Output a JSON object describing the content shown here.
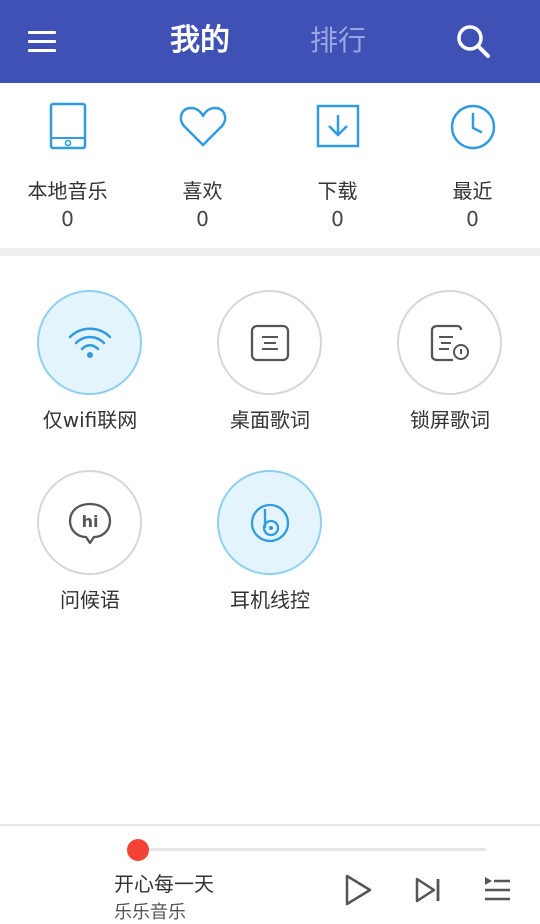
{
  "header": {
    "tabs": [
      {
        "label": "我的",
        "active": true
      },
      {
        "label": "排行",
        "active": false
      }
    ],
    "menu_icon": "menu-icon",
    "search_icon": "search-icon",
    "bg_color": "#3f51b5"
  },
  "stats": [
    {
      "label": "本地音乐",
      "count": "0",
      "icon": "tablet-icon"
    },
    {
      "label": "喜欢",
      "count": "0",
      "icon": "heart-icon"
    },
    {
      "label": "下载",
      "count": "0",
      "icon": "download-icon"
    },
    {
      "label": "最近",
      "count": "0",
      "icon": "clock-icon"
    }
  ],
  "features": [
    {
      "label": "仅wifi联网",
      "icon": "wifi-icon",
      "active": true
    },
    {
      "label": "桌面歌词",
      "icon": "desktop-lyrics-icon",
      "active": false
    },
    {
      "label": "锁屏歌词",
      "icon": "lockscreen-lyrics-icon",
      "active": false
    },
    {
      "label": "问候语",
      "icon": "greeting-hi-icon",
      "active": false
    },
    {
      "label": "耳机线控",
      "icon": "headset-control-icon",
      "active": true
    }
  ],
  "player": {
    "title": "开心每一天",
    "artist": "乐乐音乐",
    "progress": 0,
    "accent": "#f44336"
  },
  "colors": {
    "icon_blue": "#2f9be0",
    "icon_gray": "#555555"
  }
}
